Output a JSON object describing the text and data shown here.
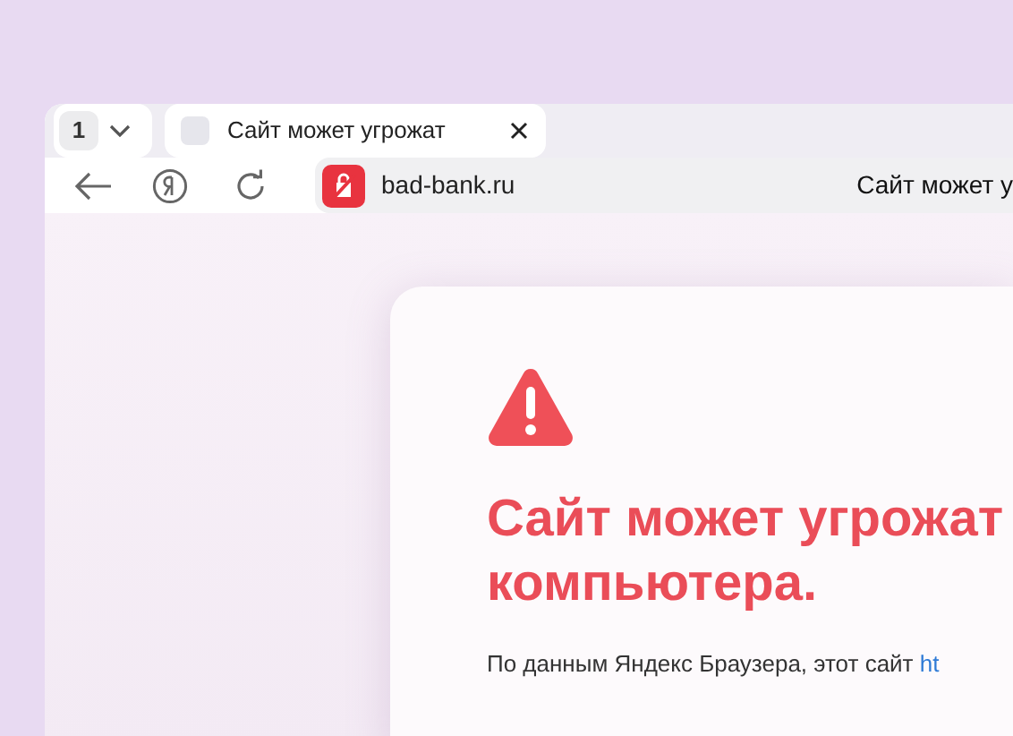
{
  "tab_counter": {
    "count": "1"
  },
  "tabs": [
    {
      "title": "Сайт может угрожат",
      "selected": true
    }
  ],
  "toolbar": {
    "address": "bad-bank.ru",
    "page_title": "Сайт может у"
  },
  "warning": {
    "heading_lines": [
      "Сайт может угрожат",
      "компьютера."
    ],
    "text": "По данным Яндекс Браузера, этот сайт ",
    "link": "ht"
  }
}
